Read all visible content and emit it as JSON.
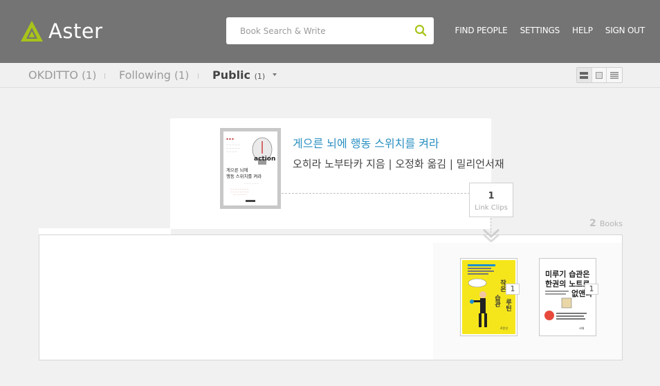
{
  "app": {
    "name": "Aster"
  },
  "search": {
    "placeholder": "Book Search & Write"
  },
  "nav": {
    "find_people": "FIND PEOPLE",
    "settings": "SETTINGS",
    "help": "HELP",
    "sign_out": "SIGN OUT"
  },
  "tabs": [
    {
      "label": "OKDITTO",
      "count": "(1)"
    },
    {
      "label": "Following",
      "count": "(1)"
    },
    {
      "label": "Public",
      "count": "(1)"
    }
  ],
  "active_tab": "Public",
  "book": {
    "title": "게으른 뇌에 행동 스위치를 켜라",
    "meta": "오히라 노부타카 지음 | 오정화 옮김 | 밀리언서재",
    "cover_title": "게으른 뇌에\n행동 스위치를 켜라",
    "cover_word": "action"
  },
  "link_clips": {
    "count": "1",
    "label": "Link Clips"
  },
  "books_total": {
    "count": "2",
    "label": "Books"
  },
  "related_books": [
    {
      "cover_text": "작은 습관 루틴",
      "clips": "1",
      "cover_color": "#f5e61c"
    },
    {
      "cover_text": "미루기 습관은 한권의 노트로 없앤다",
      "clips": "1",
      "cover_color": "#ffffff"
    }
  ],
  "colors": {
    "header_bg": "#747474",
    "accent_green": "#a8c41a",
    "link_blue": "#2a8fc2",
    "background": "#f1f1f1"
  }
}
